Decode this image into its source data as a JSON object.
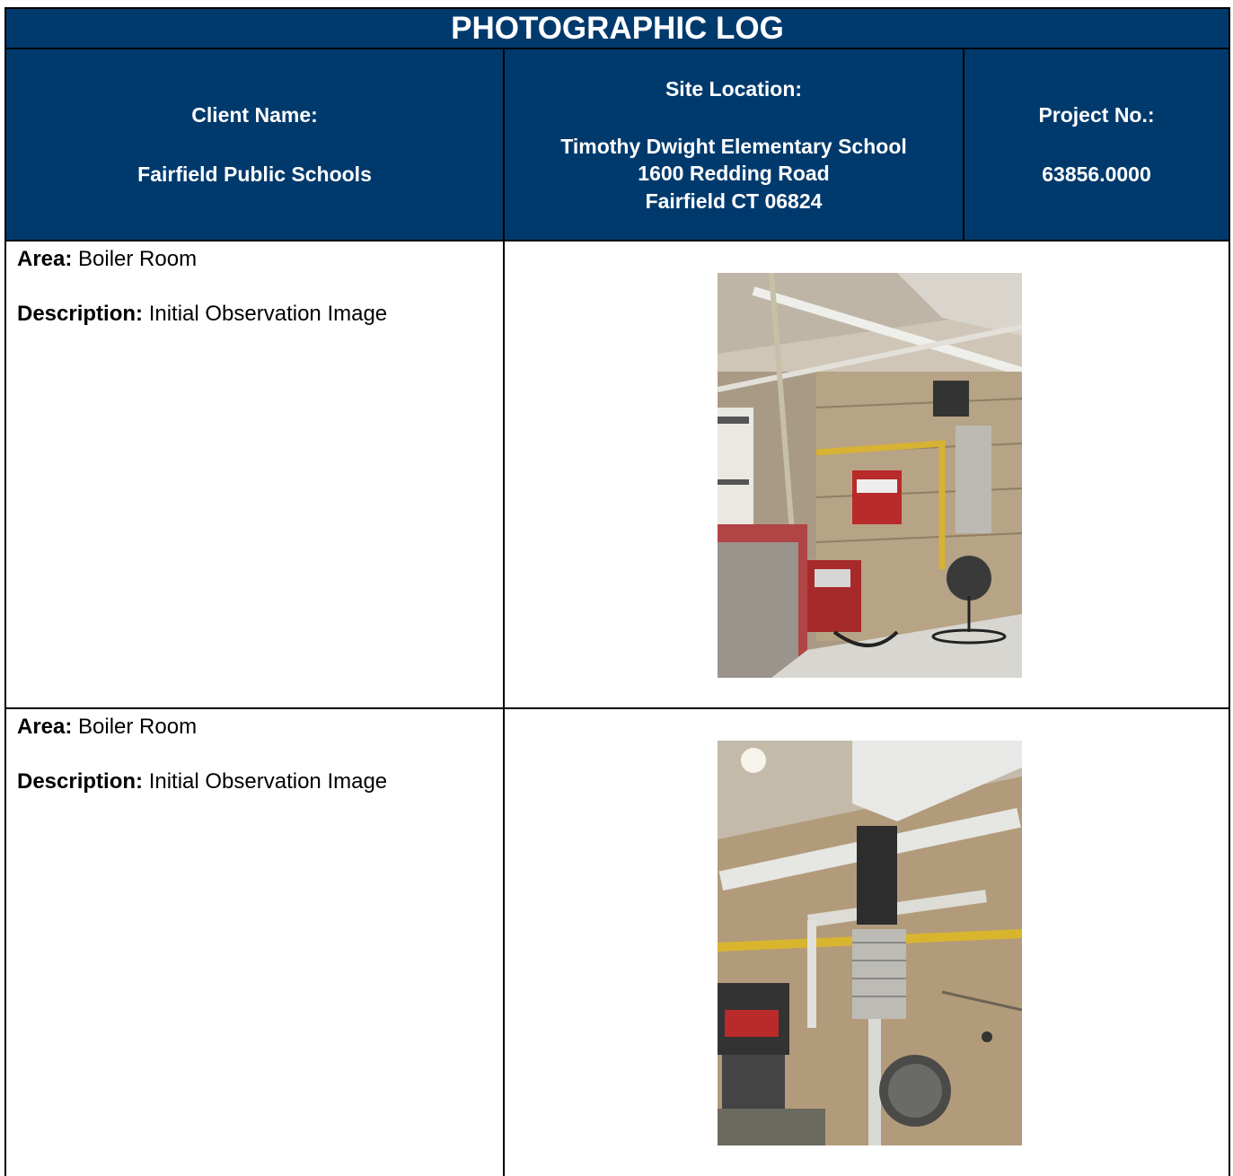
{
  "header": {
    "title": "PHOTOGRAPHIC LOG",
    "client_label": "Client Name:",
    "client_value": "Fairfield Public Schools",
    "site_label": "Site Location:",
    "site_line1": "Timothy Dwight Elementary School",
    "site_line2": "1600 Redding Road",
    "site_line3": "Fairfield CT 06824",
    "project_label": "Project No.:",
    "project_value": "63856.0000"
  },
  "entries": [
    {
      "area_label": "Area:",
      "area_value": "Boiler Room",
      "description_label": "Description:",
      "description_value": "Initial Observation Image"
    },
    {
      "area_label": "Area:",
      "area_value": "Boiler Room",
      "description_label": "Description:",
      "description_value": "Initial Observation Image"
    }
  ],
  "colors": {
    "header_bg": "#003a6d",
    "header_text": "#ffffff"
  }
}
